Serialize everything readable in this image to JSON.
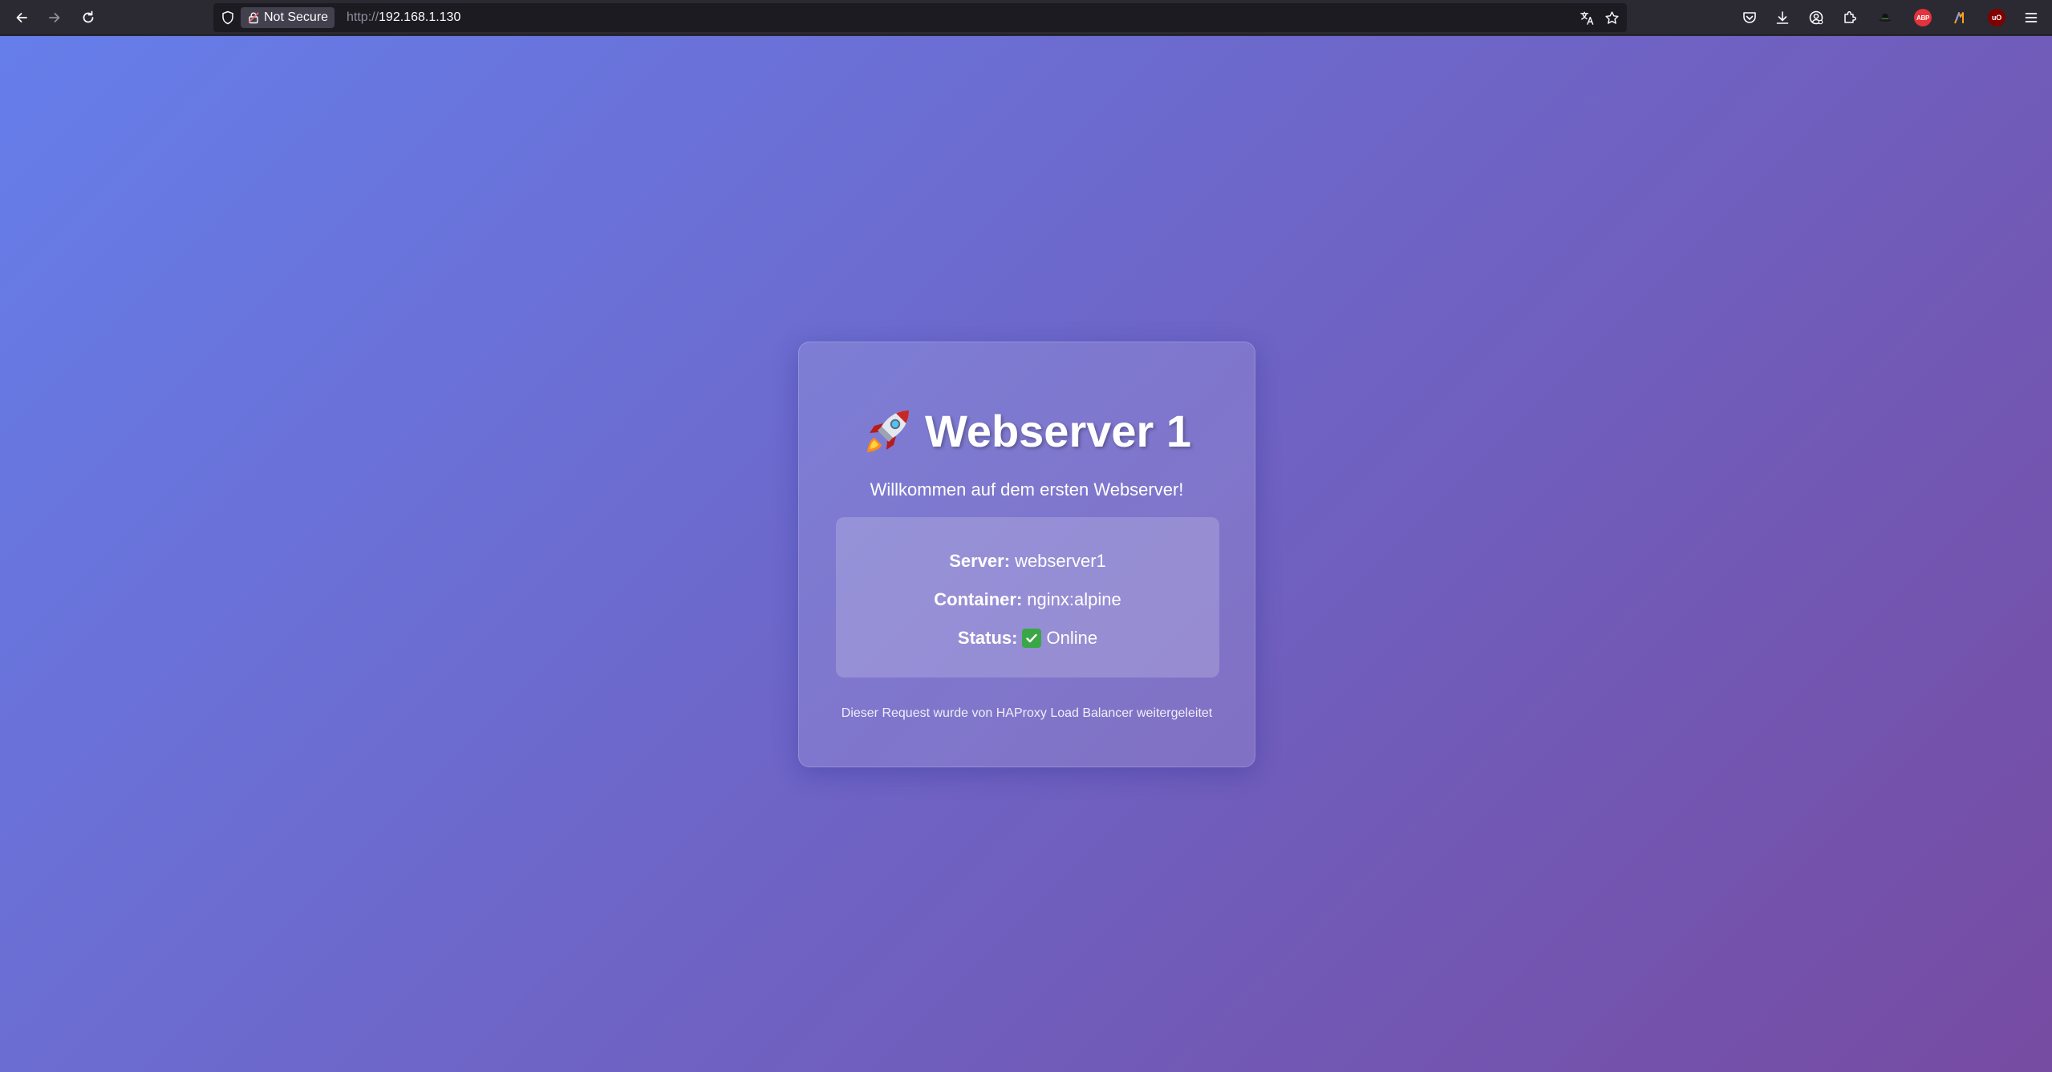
{
  "browser": {
    "security_label": "Not Secure",
    "url_protocol": "http://",
    "url_host": "192.168.1.130",
    "toolbar_icons": [
      "back-icon",
      "forward-icon",
      "reload-icon",
      "shield-icon",
      "translate-icon",
      "bookmark-star-icon",
      "pocket-icon",
      "downloads-icon",
      "account-icon",
      "extensions-icon",
      "extension-hat-icon",
      "adblock-plus-icon",
      "extension-flag-icon",
      "ublock-origin-icon",
      "menu-icon"
    ],
    "extensions": {
      "adblock": "ABP",
      "ublock": "uO"
    }
  },
  "page": {
    "title": "Webserver 1",
    "title_icon": "rocket-icon",
    "subtitle": "Willkommen auf dem ersten Webserver!",
    "info": {
      "server_label": "Server:",
      "server_value": "webserver1",
      "container_label": "Container:",
      "container_value": "nginx:alpine",
      "status_label": "Status:",
      "status_icon": "check-mark-icon",
      "status_value": "Online"
    },
    "footer": "Dieser Request wurde von HAProxy Load Balancer weitergeleitet"
  },
  "colors": {
    "gradient_start": "#667eea",
    "gradient_end": "#764ba2",
    "chrome_bg": "#2b2a33",
    "status_green": "#3aa745"
  }
}
